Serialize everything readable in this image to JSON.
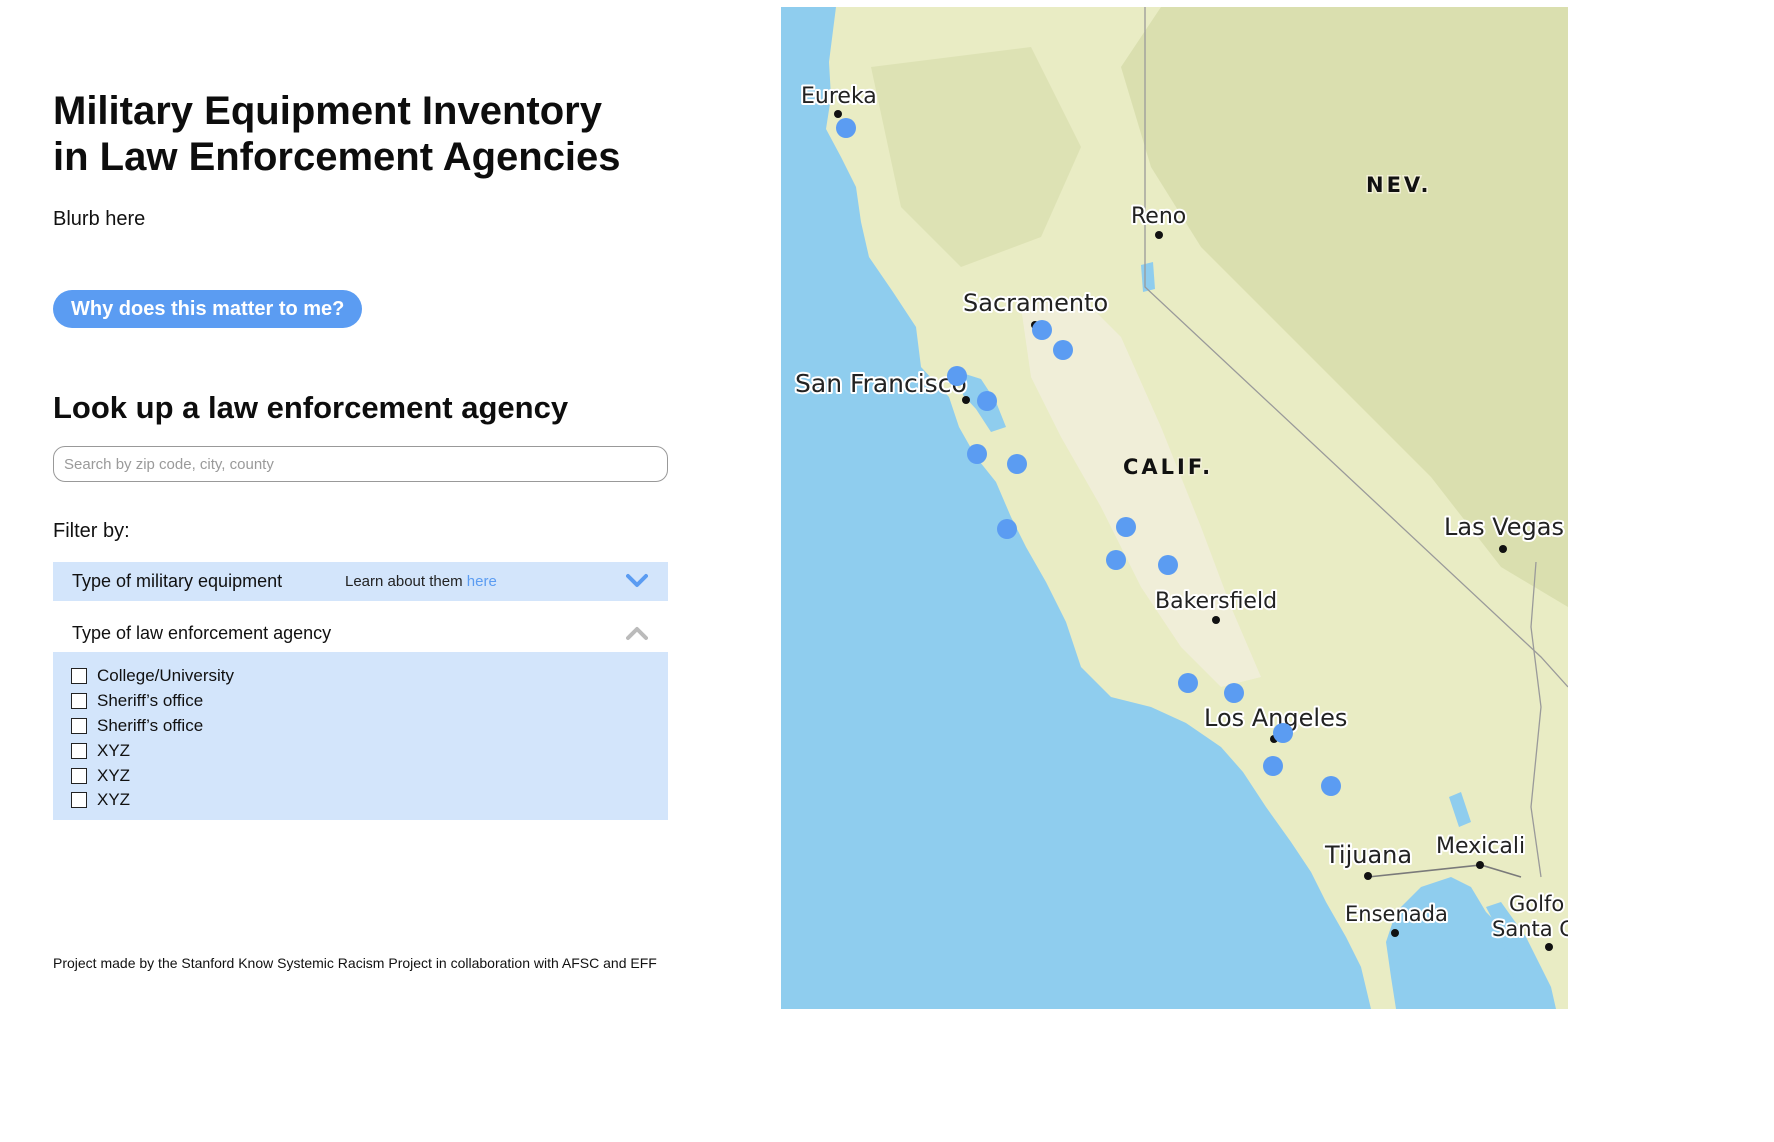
{
  "header": {
    "title_line1": "Military Equipment Inventory",
    "title_line2": "in Law Enforcement Agencies",
    "blurb": "Blurb here",
    "why_button": "Why does this matter to me?"
  },
  "lookup": {
    "title": "Look up a law enforcement agency",
    "search_placeholder": "Search by zip code, city, county",
    "search_value": ""
  },
  "filters": {
    "label": "Filter by:",
    "equipment": {
      "title": "Type of military equipment",
      "learn_text": "Learn about them ",
      "learn_link": "here",
      "state": "collapsed",
      "icon": "chevron-down-icon"
    },
    "agency": {
      "title": "Type of law enforcement agency",
      "state": "expanded",
      "icon": "chevron-up-icon",
      "options": [
        {
          "label": "College/University",
          "checked": false
        },
        {
          "label": "Sheriff’s office",
          "checked": false
        },
        {
          "label": "Sheriff’s office",
          "checked": false
        },
        {
          "label": "XYZ",
          "checked": false
        },
        {
          "label": "XYZ",
          "checked": false
        },
        {
          "label": "XYZ",
          "checked": false
        }
      ]
    }
  },
  "footer": {
    "text": "Project made by the Stanford Know Systemic Racism Project in collaboration with AFSC and EFF"
  },
  "map": {
    "cities": [
      "Eureka",
      "Reno",
      "Sacramento",
      "San Francisco",
      "Bakersfield",
      "Las Vegas",
      "Los Angeles",
      "Tijuana",
      "Mexicali",
      "Ensenada",
      "Golfo",
      "Santa C"
    ],
    "states": [
      "NEV.",
      "CALIF."
    ],
    "colors": {
      "ocean": "#8fcdee",
      "land": "#e9ecc4",
      "marker": "#5b9cf2",
      "button": "#5b9cf2",
      "filter_bg": "#d3e5fb"
    }
  }
}
